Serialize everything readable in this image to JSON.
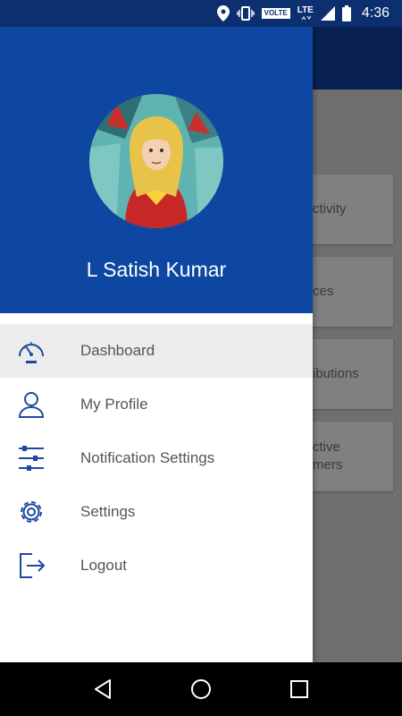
{
  "status_bar": {
    "volte": "VOLTE",
    "network": "LTE",
    "time": "4:36",
    "icons": [
      "location-icon",
      "vibrate-icon",
      "signal-icon",
      "battery-icon"
    ]
  },
  "drawer": {
    "user_name": "L Satish Kumar",
    "header_color": "#0d47a1",
    "menu": [
      {
        "label": "Dashboard",
        "icon": "speedometer-icon",
        "active": true
      },
      {
        "label": "My Profile",
        "icon": "person-icon",
        "active": false
      },
      {
        "label": "Notification Settings",
        "icon": "sliders-icon",
        "active": false
      },
      {
        "label": "Settings",
        "icon": "gear-icon",
        "active": false
      },
      {
        "label": "Logout",
        "icon": "logout-icon",
        "active": false
      }
    ]
  },
  "background": {
    "cards": [
      {
        "lines": [
          "ctivity"
        ]
      },
      {
        "lines": [
          "ces"
        ]
      },
      {
        "lines": [
          "ibutions"
        ]
      },
      {
        "lines": [
          "ctive",
          "mers"
        ]
      }
    ]
  },
  "nav_bar": {
    "buttons": [
      "back-button",
      "home-button",
      "recents-button"
    ]
  },
  "colors": {
    "accent": "#0d47a1",
    "icon": "#1c4aa0",
    "status_bar": "#0b2f6f"
  }
}
